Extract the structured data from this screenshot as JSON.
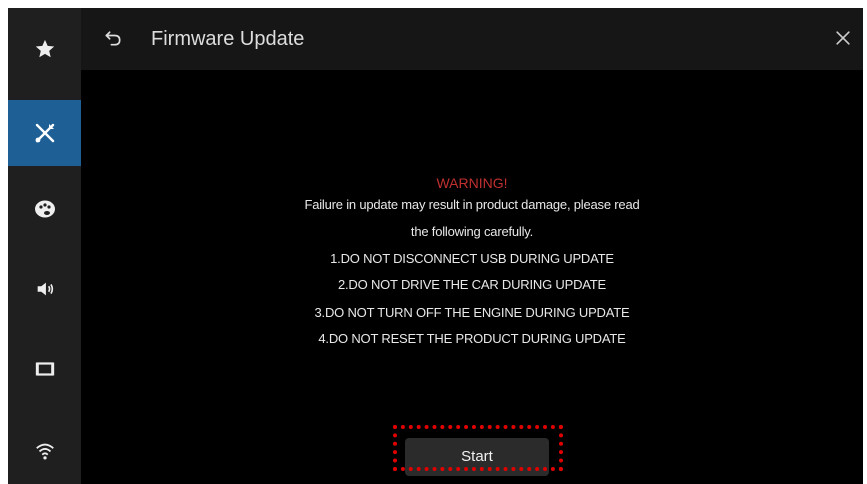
{
  "sidebar": {
    "items": [
      {
        "icon": "star-icon",
        "active": false
      },
      {
        "icon": "tools-icon",
        "active": true
      },
      {
        "icon": "palette-icon",
        "active": false
      },
      {
        "icon": "speaker-icon",
        "active": false
      },
      {
        "icon": "display-icon",
        "active": false
      },
      {
        "icon": "wifi-icon",
        "active": false
      }
    ],
    "active_color": "#1e5f96"
  },
  "header": {
    "title": "Firmware Update",
    "back_icon": "back-icon",
    "close_icon": "close-icon"
  },
  "warning": {
    "title": "WARNING!",
    "title_color": "#c03030",
    "lines": [
      "Failure in update may result in product damage, please read",
      "the following carefully.",
      "1.DO NOT DISCONNECT USB DURING UPDATE",
      "2.DO NOT DRIVE THE CAR DURING UPDATE",
      "3.DO NOT TURN OFF THE ENGINE DURING UPDATE",
      "4.DO NOT RESET THE PRODUCT DURING UPDATE"
    ]
  },
  "actions": {
    "start_label": "Start"
  },
  "highlight_color": "#e00000"
}
